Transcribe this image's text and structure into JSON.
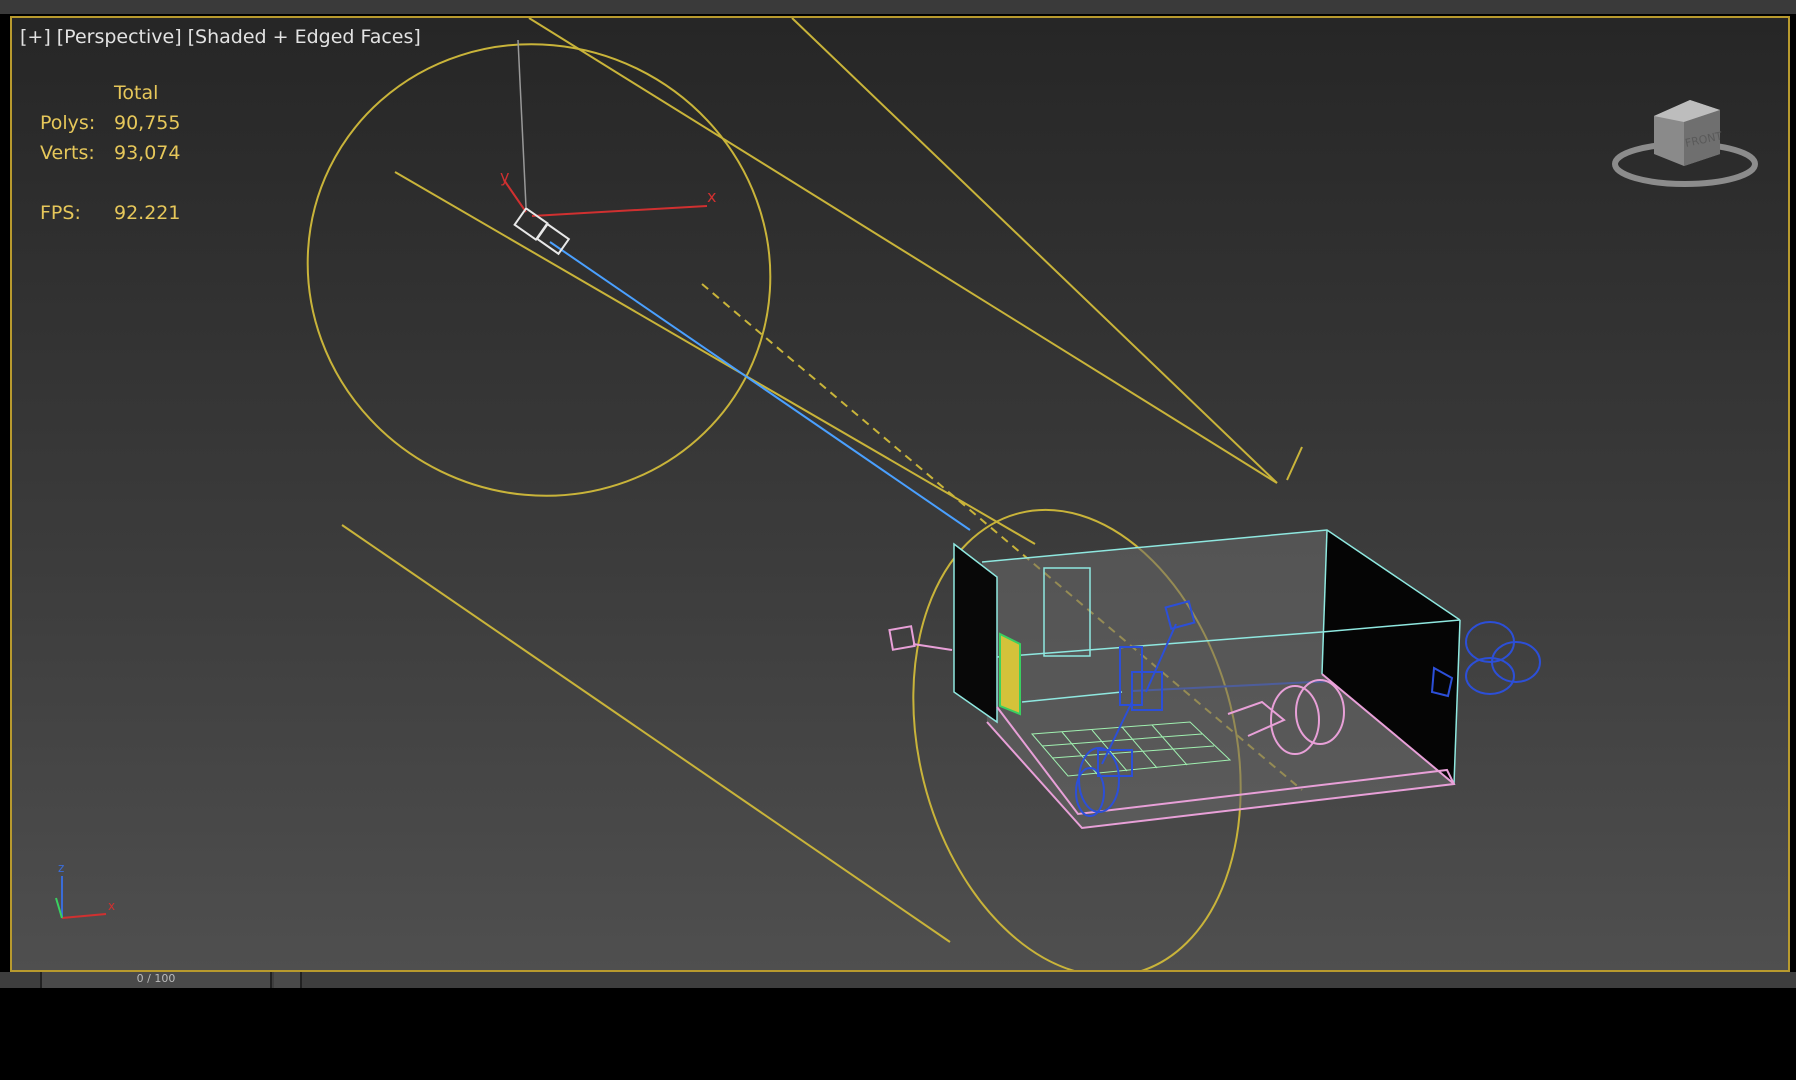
{
  "viewport": {
    "labels": {
      "plus": "[+]",
      "view": "[Perspective]",
      "shading": "[Shaded + Edged Faces]"
    },
    "stats": {
      "header": "Total",
      "polys_label": "Polys:",
      "polys_value": "90,755",
      "verts_label": "Verts:",
      "verts_value": "93,074",
      "fps_label": "FPS:",
      "fps_value": "92.221"
    },
    "viewcube": {
      "face_label": "FRONT"
    },
    "axis": {
      "z": "z",
      "x": "x"
    },
    "gizmo": {
      "x": "x",
      "y": "y"
    }
  },
  "timeline": {
    "frame_label": "0 / 100"
  },
  "colors": {
    "viewport_border": "#b89a2e",
    "stats_text": "#e6c75a",
    "light_cone": "#c9b43a",
    "room_cyan": "#8fe8e0",
    "floor_pink": "#e8a0d8",
    "camera_blue": "#2c4fd8",
    "target_line": "#4aa0ff",
    "gizmo_red": "#d03030"
  }
}
